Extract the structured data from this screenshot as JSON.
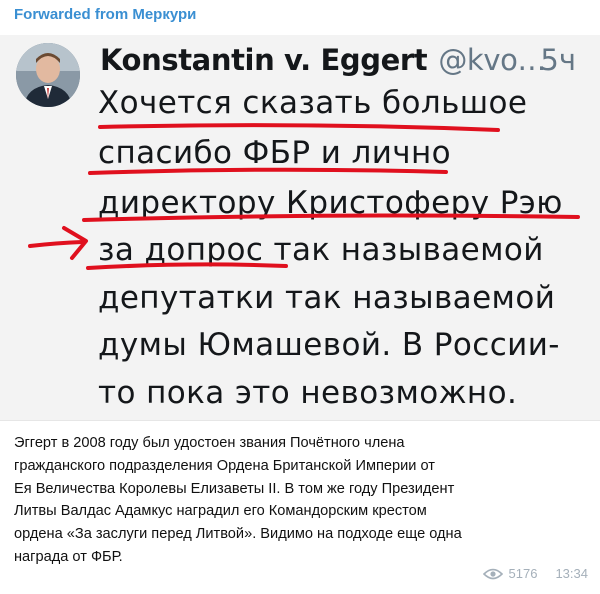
{
  "message": {
    "forwarded_from": "Forwarded from Меркури",
    "tweet": {
      "author_name": "Konstantin v. Eggert",
      "author_handle": "@kvo…",
      "time": "5ч",
      "lines": [
        "Хочется сказать большое",
        "спасибо ФБР и лично",
        "директору Кристоферу Рэю",
        "за допрос так называемой",
        "депутатки так называемой",
        "думы Юмашевой. В Росcии-",
        "то пока это невозможно."
      ]
    },
    "caption_lines": [
      "Эггерт в 2008 году был удостоен звания Почётного члена",
      "гражданского подразделения Ордена Британской Империи от",
      "Ея Величества Королевы Елизаветы II. В том же году Президент",
      "Литвы Валдас Адамкус наградил его Командорским крестом",
      "ордена «За заслуги перед Литвой». Видимо на подходе еще одна",
      "награда от ФБР."
    ],
    "views": "5176",
    "time": "13:34"
  },
  "colors": {
    "forwarded": "#3a8fd2",
    "annotation": "#e0101e",
    "meta": "#a5b0ba"
  },
  "icons": {
    "views": "eye-icon"
  }
}
